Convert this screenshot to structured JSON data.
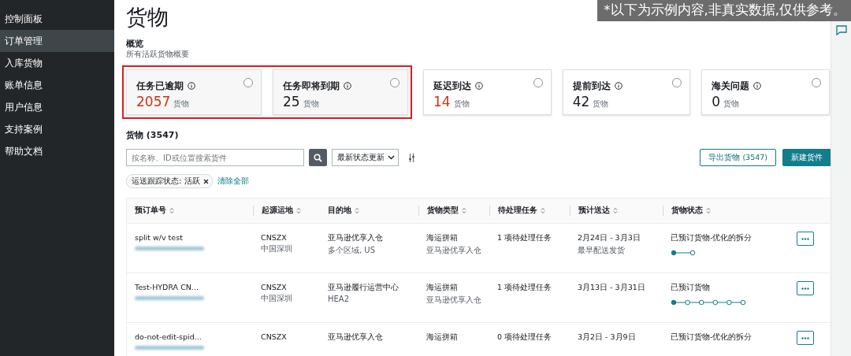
{
  "sidebar": {
    "items": [
      {
        "label": "控制面板",
        "selected": false
      },
      {
        "label": "订单管理",
        "selected": true
      },
      {
        "label": "入库货物",
        "selected": false
      },
      {
        "label": "账单信息",
        "selected": false
      },
      {
        "label": "用户信息",
        "selected": false
      },
      {
        "label": "支持案例",
        "selected": false
      },
      {
        "label": "帮助文档",
        "selected": false
      }
    ]
  },
  "page_title": "货物",
  "disclaimer": "*以下为示例内容,非真实数据,仅供参考。",
  "overview": {
    "title": "概览",
    "subtitle": "所有活跃货物概要",
    "cards": [
      {
        "title": "任务已逾期",
        "count": "2057",
        "unit": "货物",
        "alert": true,
        "highlighted": true,
        "selected": false
      },
      {
        "title": "任务即将到期",
        "count": "25",
        "unit": "货物",
        "alert": false,
        "highlighted": true,
        "selected": false
      },
      {
        "title": "延迟到达",
        "count": "14",
        "unit": "货物",
        "alert": true,
        "highlighted": false,
        "selected": false
      },
      {
        "title": "提前到达",
        "count": "42",
        "unit": "货物",
        "alert": false,
        "highlighted": false,
        "selected": false
      },
      {
        "title": "海关问题",
        "count": "0",
        "unit": "货物",
        "alert": false,
        "highlighted": false,
        "selected": false
      }
    ]
  },
  "shipments": {
    "title": "货物 (3547)",
    "search": {
      "placeholder": "按名称、ID或位置搜索货件"
    },
    "sort": "最新状态更新",
    "export_button": "导出货物 (3547)",
    "new_button": "新建货件",
    "filter_chip": "运送跟踪状态: 活跃",
    "clear_all": "清除全部",
    "table": {
      "columns": [
        "预订单号",
        "起源运地",
        "目的地",
        "货物类型",
        "待处理任务",
        "预计送达",
        "货物状态"
      ],
      "rows": [
        {
          "name": "split w/v test",
          "origin": "CNSZX",
          "origin_sub": "中国深圳",
          "dest": "亚马逊优享入仓",
          "dest_sub": "多个区域, US",
          "type": "海运拼箱",
          "type_sub": "亚马逊优享入仓",
          "tasks": "1 项待处理任务",
          "eta": "2月24日 - 3月3日",
          "eta_sub": "最早配送发货",
          "status": "已预订货物-优化的拆分",
          "steps": [
            {
              "done": true
            },
            {
              "done": false
            }
          ]
        },
        {
          "name": "Test-HYDRA CN...",
          "origin": "CNSZX",
          "origin_sub": "中国深圳",
          "dest": "亚马逊履行运营中心",
          "dest_sub": "HEA2",
          "type": "海运拼箱",
          "type_sub": "亚马逊优享入仓",
          "tasks": "1 项待处理任务",
          "eta": "3月13日 - 3月31日",
          "status": "已预订货物",
          "steps": [
            {
              "done": true
            },
            {
              "done": false
            },
            {
              "done": false
            },
            {
              "done": false
            },
            {
              "done": false
            },
            {
              "done": false
            }
          ]
        },
        {
          "name": "do-not-edit-spid...",
          "origin": "CNSZX",
          "dest": "亚马逊优享入仓",
          "type": "海运拼箱",
          "tasks": "0 项待处理任务",
          "eta": "3月2日 - 3月9日",
          "status": "已预订货物-优化的拆分"
        }
      ]
    }
  }
}
